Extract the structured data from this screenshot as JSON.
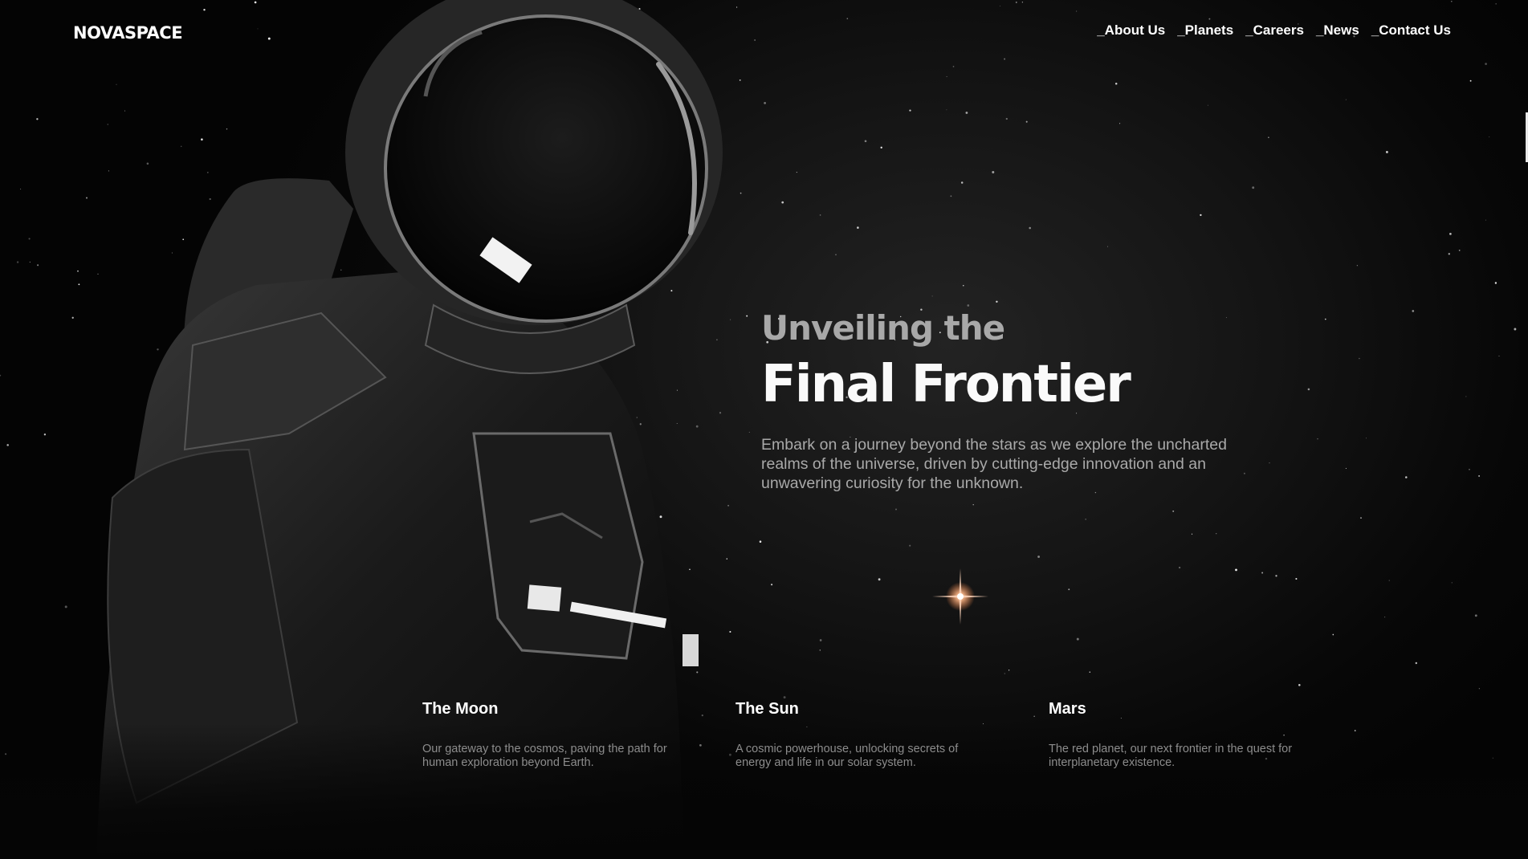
{
  "brand": {
    "logo": "NOVASPACE"
  },
  "nav": [
    {
      "label": "_About Us"
    },
    {
      "label": "_Planets"
    },
    {
      "label": "_Careers"
    },
    {
      "label": "_News"
    },
    {
      "label": "_Contact Us"
    }
  ],
  "hero": {
    "subtitle": "Unveiling the",
    "title": "Final Frontier",
    "description": "Embark on a journey beyond the stars as we explore the uncharted realms of the universe, driven by cutting-edge innovation and an unwavering curiosity for the unknown."
  },
  "cards": [
    {
      "title": "The Moon",
      "text": "Our gateway to the cosmos, paving the path for human exploration beyond Earth."
    },
    {
      "title": "The Sun",
      "text": "A cosmic powerhouse, unlocking secrets of energy and life in our solar system."
    },
    {
      "title": "Mars",
      "text": "The red planet, our next frontier in the quest for interplanetary existence."
    }
  ],
  "colors": {
    "background": "#050505",
    "text": "#ffffff",
    "muted": "#a9a9a9",
    "flare": "#ffb98a"
  },
  "icons": {
    "hero_image": "astronaut-illustration",
    "star": "star-flare-icon"
  }
}
